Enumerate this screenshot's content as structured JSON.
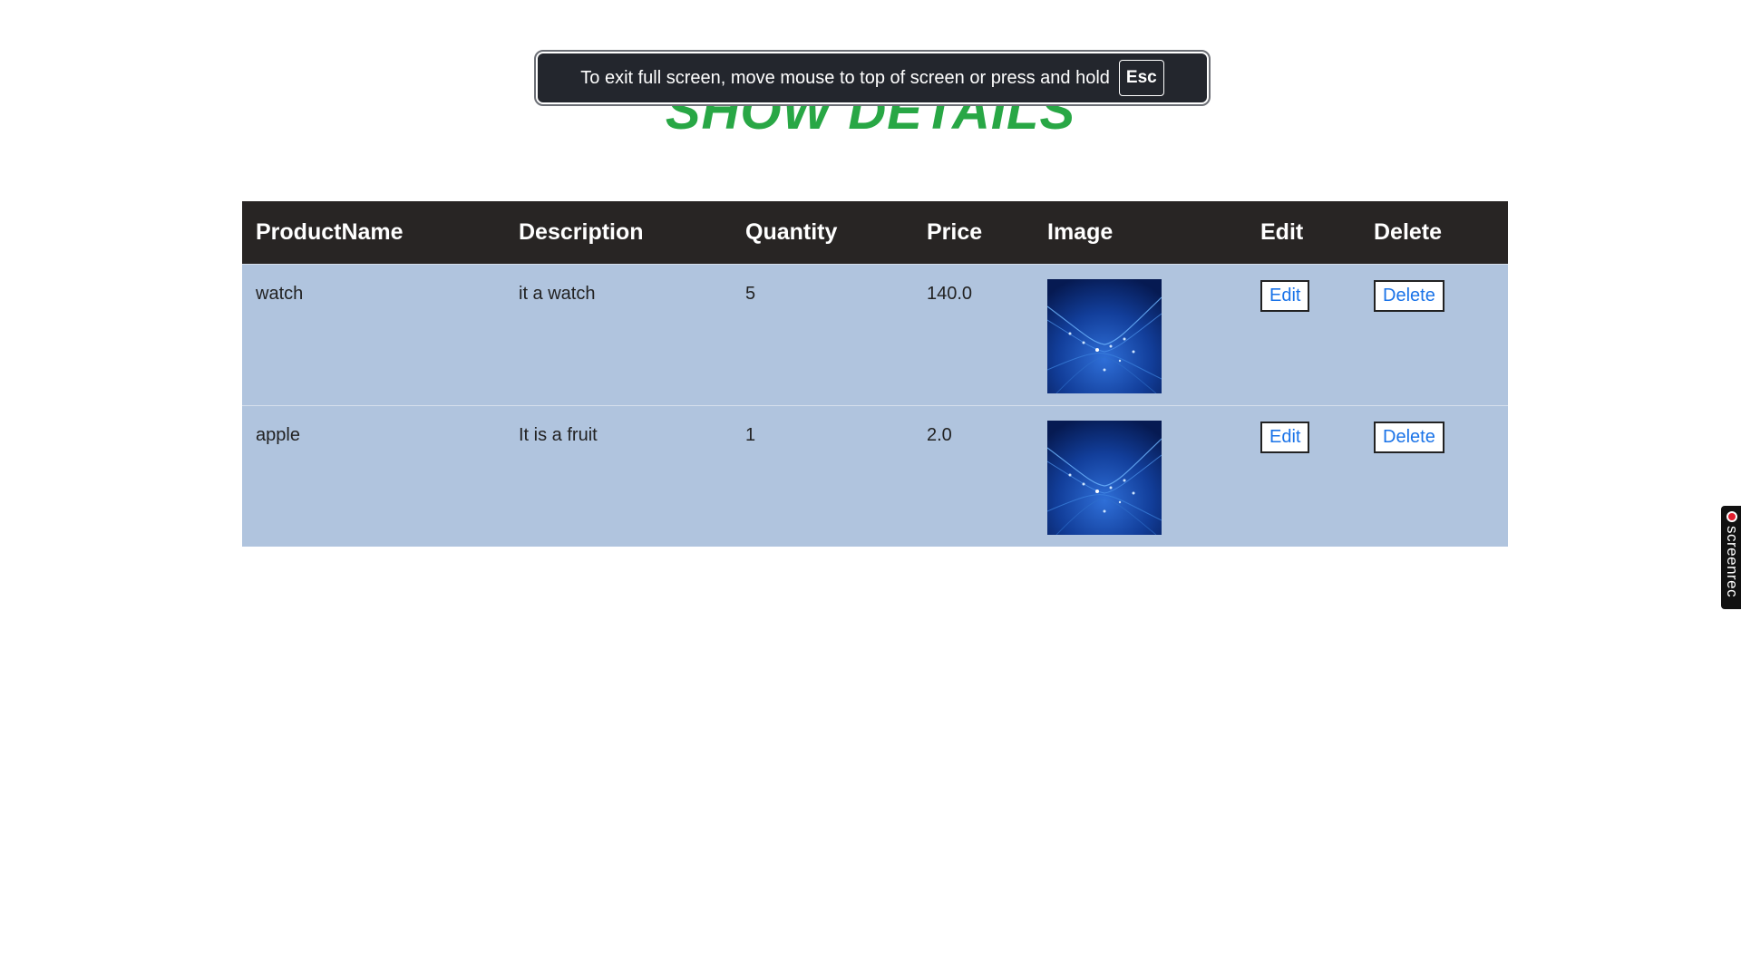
{
  "page": {
    "title": "SHOW DETAILS"
  },
  "fullscreen_notice": {
    "message": "To exit full screen, move mouse to top of screen or press and hold",
    "key": "Esc"
  },
  "table": {
    "headers": [
      "ProductName",
      "Description",
      "Quantity",
      "Price",
      "Image",
      "Edit",
      "Delete"
    ],
    "rows": [
      {
        "product_name": "watch",
        "description": "it a watch",
        "quantity": "5",
        "price": "140.0",
        "image_icon": "product-image",
        "edit_label": "Edit",
        "delete_label": "Delete"
      },
      {
        "product_name": "apple",
        "description": "It is a fruit",
        "quantity": "1",
        "price": "2.0",
        "image_icon": "product-image",
        "edit_label": "Edit",
        "delete_label": "Delete"
      }
    ]
  },
  "screenrec": {
    "label": "screenrec"
  },
  "colors": {
    "title": "#28a745",
    "header_bg": "#282524",
    "row_bg": "#b0c4de",
    "button_text": "#1a73e8"
  }
}
